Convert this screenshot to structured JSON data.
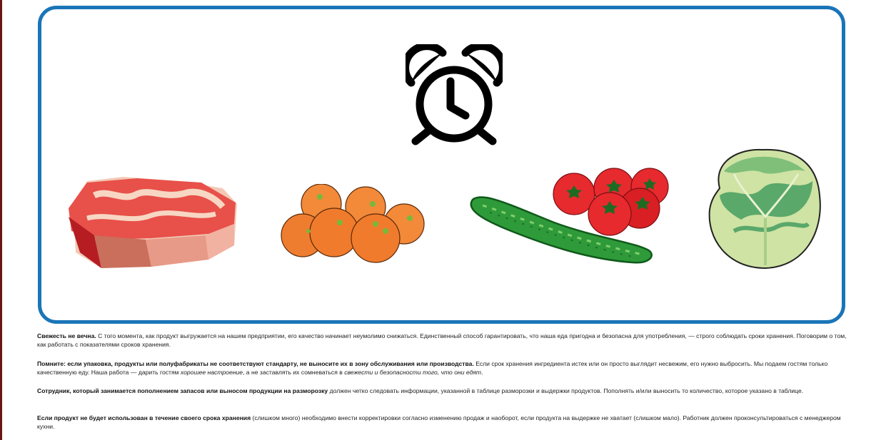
{
  "illustration": {
    "icons": [
      "alarm-clock-icon",
      "meat-steak-icon",
      "oranges-icon",
      "cucumber-icon",
      "tomatoes-icon",
      "cabbage-icon"
    ],
    "colors": {
      "frame": "#1a75b8",
      "accent_edge": "#6b1414"
    }
  },
  "paragraphs": [
    {
      "bold": "Свежесть не вечна.",
      "text": " С того момента, как продукт выгружается на нашем предприятии, его качество начинает неумолимо снижаться. Единственный способ гарантировать, что наша еда пригодна и безопасна для употребления, — строго соблюдать сроки хранения. Поговорим о том, как работать с показателями сроков хранения."
    },
    {
      "bold": "Помните: если упаковка, продукты или полуфабрикаты не соответствуют стандарту, не выносите их в зону обслуживания или производства.",
      "text": " Если срок хранения ингредиента истек или он просто выглядит несвежим, его нужно выбросить. Мы подаем гостям только качественную еду. Наша работа — дарить гостям ",
      "italic1": "хорошее настроение",
      "text2": ", а не заставлять их сомневаться в ",
      "italic2": "свежести и безопасности того, что они едят",
      "text3": "."
    },
    {
      "bold": "Сотрудник, который занимается пополнением запасов или выносом продукции на разморозку",
      "text": " должен четко следовать информации, указанной в таблице разморозки и выдержки продуктов. Пополнять и/или выносить то количество, которое указано в таблице."
    },
    {
      "bold": "Если продукт не будет использован в течение своего срока хранения",
      "text": " (слишком много) необходимо внести корректировки согласно изменению продаж и наоборот, если продукта на выдержке не хватает (слишком мало). Работник должен проконсультироваться с менеджером кухни."
    }
  ]
}
